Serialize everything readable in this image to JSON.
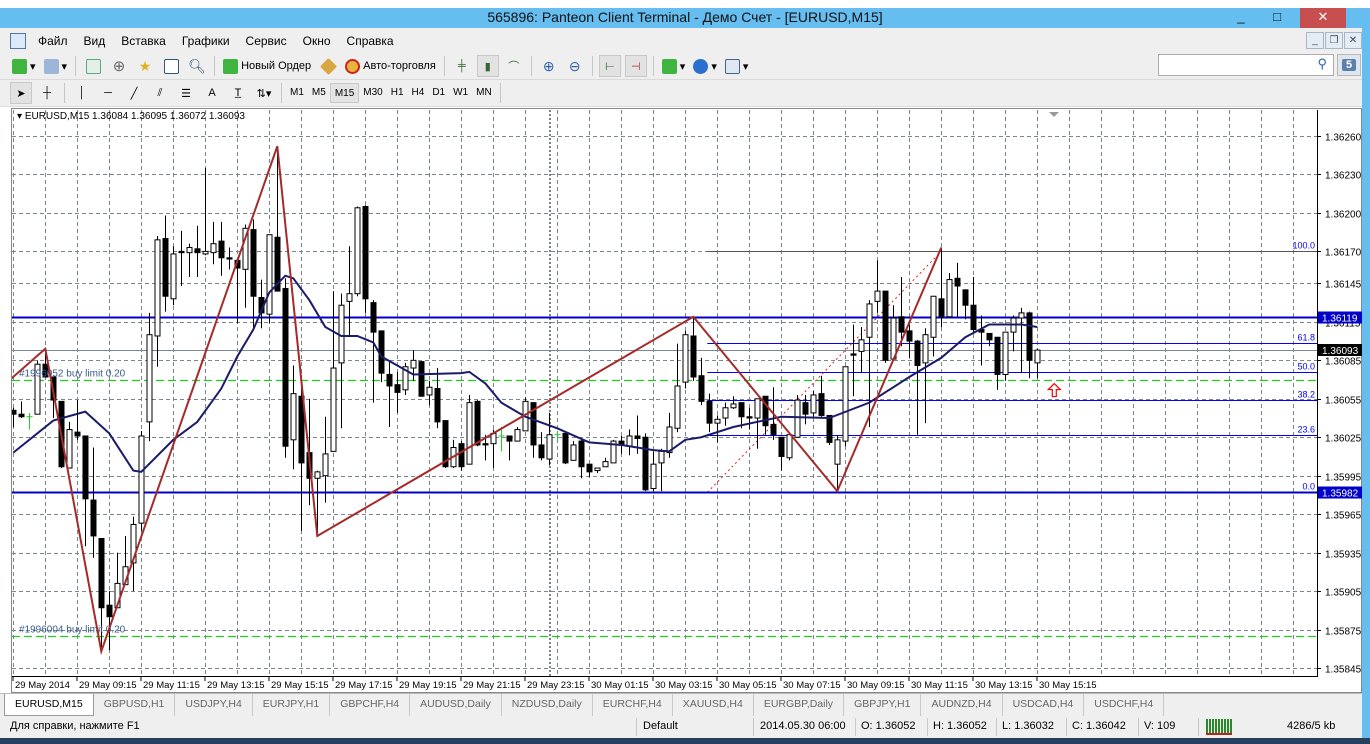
{
  "window": {
    "title": "565896: Panteon Client Terminal - Демо Счет - [EURUSD,M15]",
    "minimize": "_",
    "maximize": "□",
    "close": "✕"
  },
  "menu": [
    "Файл",
    "Вид",
    "Вставка",
    "Графики",
    "Сервис",
    "Окно",
    "Справка"
  ],
  "mdi_controls": {
    "minimize": "_",
    "restore": "❐",
    "close": "✕"
  },
  "toolbar": {
    "new_order": "Новый Ордер",
    "auto_trading": "Авто-торговля"
  },
  "timeframes": [
    "M1",
    "M5",
    "M15",
    "M30",
    "H1",
    "H4",
    "D1",
    "W1",
    "MN"
  ],
  "active_timeframe": "M15",
  "search": {
    "placeholder": "",
    "icon": "search-icon"
  },
  "chat": {
    "count": "5"
  },
  "chart": {
    "header": "EURUSD,M15  1.36084 1.36095 1.36072 1.36093",
    "orders": [
      {
        "label": "#1996052 buy limit 0.20",
        "price": 1.3607
      },
      {
        "label": "#1996004 buy limit 0.20",
        "price": 1.3587
      }
    ],
    "hlines": [
      {
        "price": 1.36119,
        "label": "1.36119"
      },
      {
        "price": 1.35982,
        "label": "1.35982"
      }
    ],
    "bid": {
      "price": 1.36093,
      "label": "1.36093"
    },
    "fibo": {
      "from_bar": 88,
      "high": 1.3617,
      "low": 1.35982,
      "levels": [
        {
          "label": "100.0",
          "ratio": 1
        },
        {
          "label": "61.8",
          "ratio": 0.618
        },
        {
          "label": "50.0",
          "ratio": 0.5
        },
        {
          "label": "38.2",
          "ratio": 0.382
        },
        {
          "label": "23.6",
          "ratio": 0.236
        },
        {
          "label": "0.0",
          "ratio": 0
        }
      ]
    },
    "colors": {
      "zigzag": "#a52a2a",
      "ma": "#1b1b6b",
      "hline": "#0000c8",
      "fibo": "#0000ff",
      "order": "#22cc22",
      "arrow": "#ff0000"
    }
  },
  "chart_data": {
    "type": "candlestick",
    "symbol": "EURUSD",
    "timeframe": "M15",
    "ylim": [
      1.3583,
      1.3628
    ],
    "price_ticks": [
      "1.36260",
      "1.36230",
      "1.36200",
      "1.36170",
      "1.36145",
      "1.36115",
      "1.36085",
      "1.36055",
      "1.36025",
      "1.35995",
      "1.35965",
      "1.35935",
      "1.35905",
      "1.35875",
      "1.35845"
    ],
    "time_ticks": [
      "29 May 2014",
      "29 May 09:15",
      "29 May 11:15",
      "29 May 13:15",
      "29 May 15:15",
      "29 May 17:15",
      "29 May 19:15",
      "29 May 21:15",
      "29 May 23:15",
      "30 May 01:15",
      "30 May 03:15",
      "30 May 05:15",
      "30 May 07:15",
      "30 May 09:15",
      "30 May 11:15",
      "30 May 13:15",
      "30 May 15:15"
    ],
    "grid": true,
    "ohlc": [
      [
        1.36046,
        1.36048,
        1.36033,
        1.36043
      ],
      [
        1.36043,
        1.36053,
        1.3604,
        1.36041
      ],
      [
        1.36041,
        1.36044,
        1.36031,
        1.36041
      ],
      [
        1.36043,
        1.36085,
        1.36043,
        1.36082
      ],
      [
        1.36082,
        1.36094,
        1.36072,
        1.36072
      ],
      [
        1.36072,
        1.36072,
        1.3604,
        1.36054
      ],
      [
        1.36053,
        1.36053,
        1.36001,
        1.36002
      ],
      [
        1.36001,
        1.36037,
        1.36001,
        1.36031
      ],
      [
        1.36029,
        1.36054,
        1.36023,
        1.36026
      ],
      [
        1.36026,
        1.36026,
        1.3594,
        1.35977
      ],
      [
        1.35976,
        1.36017,
        1.35931,
        1.35948
      ],
      [
        1.35946,
        1.35946,
        1.35858,
        1.35892
      ],
      [
        1.35894,
        1.35905,
        1.35859,
        1.35885
      ],
      [
        1.35892,
        1.35935,
        1.35892,
        1.35911
      ],
      [
        1.3591,
        1.35948,
        1.3591,
        1.35924
      ],
      [
        1.35927,
        1.35963,
        1.35905,
        1.35957
      ],
      [
        1.35958,
        1.3603,
        1.35952,
        1.36026
      ],
      [
        1.36037,
        1.36122,
        1.36022,
        1.36105
      ],
      [
        1.36104,
        1.36182,
        1.3608,
        1.36179
      ],
      [
        1.3618,
        1.36198,
        1.36123,
        1.36135
      ],
      [
        1.36133,
        1.36174,
        1.36128,
        1.36168
      ],
      [
        1.3617,
        1.36186,
        1.36143,
        1.36169
      ],
      [
        1.36169,
        1.36176,
        1.3615,
        1.36173
      ],
      [
        1.36172,
        1.3619,
        1.3615,
        1.36169
      ],
      [
        1.36168,
        1.36235,
        1.36167,
        1.3617
      ],
      [
        1.36169,
        1.36193,
        1.3616,
        1.36176
      ],
      [
        1.36178,
        1.36193,
        1.36151,
        1.36165
      ],
      [
        1.36165,
        1.36173,
        1.36156,
        1.36164
      ],
      [
        1.36163,
        1.36163,
        1.36114,
        1.36157
      ],
      [
        1.36156,
        1.36191,
        1.36126,
        1.36188
      ],
      [
        1.36187,
        1.36195,
        1.3611,
        1.36135
      ],
      [
        1.36134,
        1.36148,
        1.3611,
        1.36122
      ],
      [
        1.36121,
        1.36183,
        1.36114,
        1.36183
      ],
      [
        1.36181,
        1.36252,
        1.36139,
        1.36139
      ],
      [
        1.36141,
        1.36149,
        1.36009,
        1.36018
      ],
      [
        1.36023,
        1.36081,
        1.36,
        1.36059
      ],
      [
        1.36057,
        1.3607,
        1.35952,
        1.36005
      ],
      [
        1.36013,
        1.36055,
        1.35972,
        1.35993
      ],
      [
        1.35993,
        1.35999,
        1.35948,
        1.35998
      ],
      [
        1.35995,
        1.36041,
        1.35974,
        1.36012
      ],
      [
        1.36014,
        1.36139,
        1.36014,
        1.36079
      ],
      [
        1.36083,
        1.36137,
        1.36032,
        1.36128
      ],
      [
        1.36131,
        1.36174,
        1.36104,
        1.36137
      ],
      [
        1.36137,
        1.36205,
        1.36135,
        1.36204
      ],
      [
        1.36205,
        1.36206,
        1.36122,
        1.36133
      ],
      [
        1.3613,
        1.36132,
        1.36052,
        1.36107
      ],
      [
        1.36108,
        1.36108,
        1.36068,
        1.36075
      ],
      [
        1.36074,
        1.36085,
        1.36033,
        1.36065
      ],
      [
        1.36066,
        1.36076,
        1.36044,
        1.3606
      ],
      [
        1.36062,
        1.36083,
        1.36058,
        1.3608
      ],
      [
        1.36079,
        1.36093,
        1.36069,
        1.36085
      ],
      [
        1.36084,
        1.36084,
        1.36057,
        1.36057
      ],
      [
        1.36058,
        1.36069,
        1.3605,
        1.36064
      ],
      [
        1.36063,
        1.36079,
        1.36032,
        1.36037
      ],
      [
        1.36038,
        1.36038,
        1.36001,
        1.36002
      ],
      [
        1.36002,
        1.36023,
        1.36001,
        1.36017
      ],
      [
        1.3602,
        1.36022,
        1.35999,
        1.36002
      ],
      [
        1.36004,
        1.36058,
        1.36004,
        1.36052
      ],
      [
        1.36053,
        1.36054,
        1.36018,
        1.36019
      ],
      [
        1.3602,
        1.36027,
        1.36007,
        1.36019
      ],
      [
        1.3602,
        1.36031,
        1.36001,
        1.36028
      ],
      [
        1.36026,
        1.36033,
        1.36014,
        1.36026
      ],
      [
        1.36026,
        1.36026,
        1.36007,
        1.36022
      ],
      [
        1.36022,
        1.36033,
        1.36022,
        1.36031
      ],
      [
        1.3603,
        1.36056,
        1.3603,
        1.36053
      ],
      [
        1.36052,
        1.36052,
        1.36009,
        1.36019
      ],
      [
        1.36019,
        1.36029,
        1.36007,
        1.36009
      ],
      [
        1.36008,
        1.36044,
        1.36003,
        1.36027
      ],
      [
        1.36027,
        1.3603,
        1.36022,
        1.36027
      ],
      [
        1.36028,
        1.36028,
        1.36004,
        1.36005
      ],
      [
        1.36007,
        1.36022,
        1.36007,
        1.36019
      ],
      [
        1.36022,
        1.36023,
        1.35993,
        1.36002
      ],
      [
        1.36004,
        1.36004,
        1.35994,
        1.35998
      ],
      [
        1.35999,
        1.36001,
        1.35997,
        1.36001
      ],
      [
        1.36002,
        1.36009,
        1.36002,
        1.36006
      ],
      [
        1.36005,
        1.36023,
        1.36005,
        1.36022
      ],
      [
        1.36022,
        1.36026,
        1.36012,
        1.36019
      ],
      [
        1.36018,
        1.36031,
        1.36011,
        1.36026
      ],
      [
        1.36026,
        1.36042,
        1.36012,
        1.36024
      ],
      [
        1.36025,
        1.36028,
        1.35983,
        1.35984
      ],
      [
        1.35985,
        1.36014,
        1.35983,
        1.36004
      ],
      [
        1.36005,
        1.36016,
        1.35983,
        1.36014
      ],
      [
        1.36013,
        1.36044,
        1.36009,
        1.36033
      ],
      [
        1.36032,
        1.36098,
        1.36029,
        1.36065
      ],
      [
        1.36068,
        1.36108,
        1.36063,
        1.36105
      ],
      [
        1.36104,
        1.36119,
        1.36069,
        1.36072
      ],
      [
        1.36073,
        1.36087,
        1.3605,
        1.36053
      ],
      [
        1.36053,
        1.36059,
        1.36029,
        1.36036
      ],
      [
        1.36036,
        1.36042,
        1.36021,
        1.36039
      ],
      [
        1.3604,
        1.36052,
        1.36034,
        1.36048
      ],
      [
        1.36048,
        1.36057,
        1.36047,
        1.36051
      ],
      [
        1.36052,
        1.36052,
        1.36032,
        1.36041
      ],
      [
        1.36041,
        1.36048,
        1.36031,
        1.3604
      ],
      [
        1.3604,
        1.36055,
        1.36016,
        1.36055
      ],
      [
        1.36057,
        1.36057,
        1.36027,
        1.36034
      ],
      [
        1.36035,
        1.36064,
        1.36023,
        1.36027
      ],
      [
        1.36025,
        1.36025,
        1.35999,
        1.3601
      ],
      [
        1.36009,
        1.36027,
        1.36007,
        1.36027
      ],
      [
        1.36025,
        1.36058,
        1.36025,
        1.36054
      ],
      [
        1.36052,
        1.36058,
        1.36035,
        1.36043
      ],
      [
        1.36044,
        1.36061,
        1.36041,
        1.36058
      ],
      [
        1.36059,
        1.36073,
        1.36041,
        1.36042
      ],
      [
        1.36042,
        1.36042,
        1.36019,
        1.36021
      ],
      [
        1.36004,
        1.36026,
        1.35983,
        1.36023
      ],
      [
        1.36022,
        1.3608,
        1.36018,
        1.3608
      ],
      [
        1.3609,
        1.36113,
        1.36057,
        1.36089
      ],
      [
        1.36092,
        1.36111,
        1.36075,
        1.36101
      ],
      [
        1.36103,
        1.36132,
        1.36033,
        1.36129
      ],
      [
        1.36131,
        1.36163,
        1.36122,
        1.36139
      ],
      [
        1.36139,
        1.36139,
        1.36083,
        1.36085
      ],
      [
        1.36086,
        1.36128,
        1.36086,
        1.36118
      ],
      [
        1.36119,
        1.3615,
        1.36096,
        1.36107
      ],
      [
        1.36108,
        1.36113,
        1.36087,
        1.361
      ],
      [
        1.361,
        1.36101,
        1.36027,
        1.36081
      ],
      [
        1.36083,
        1.3611,
        1.36036,
        1.36105
      ],
      [
        1.36103,
        1.36135,
        1.36088,
        1.36135
      ],
      [
        1.36133,
        1.36173,
        1.36111,
        1.36119
      ],
      [
        1.36119,
        1.36153,
        1.36119,
        1.36148
      ],
      [
        1.36149,
        1.36161,
        1.36119,
        1.36143
      ],
      [
        1.3614,
        1.3614,
        1.36117,
        1.36128
      ],
      [
        1.36128,
        1.3615,
        1.36106,
        1.36109
      ],
      [
        1.36109,
        1.3612,
        1.36081,
        1.36107
      ],
      [
        1.36106,
        1.36106,
        1.36096,
        1.36101
      ],
      [
        1.36103,
        1.36103,
        1.36062,
        1.36074
      ],
      [
        1.36074,
        1.36107,
        1.36069,
        1.36107
      ],
      [
        1.36107,
        1.3612,
        1.36092,
        1.36118
      ],
      [
        1.36118,
        1.36126,
        1.36075,
        1.36122
      ],
      [
        1.36122,
        1.36123,
        1.36071,
        1.36085
      ],
      [
        1.36083,
        1.36094,
        1.36071,
        1.36093
      ]
    ],
    "moving_average": [
      [
        1,
        1.36013
      ],
      [
        6,
        1.36038
      ],
      [
        10,
        1.36045
      ],
      [
        13,
        1.36028
      ],
      [
        16,
        1.35999
      ],
      [
        17,
        1.35998
      ],
      [
        21,
        1.36023
      ],
      [
        24,
        1.36037
      ],
      [
        27,
        1.36063
      ],
      [
        29,
        1.36088
      ],
      [
        31,
        1.36109
      ],
      [
        33,
        1.36138
      ],
      [
        35,
        1.36151
      ],
      [
        36,
        1.36149
      ],
      [
        38,
        1.36132
      ],
      [
        40,
        1.36111
      ],
      [
        42,
        1.36104
      ],
      [
        44,
        1.36104
      ],
      [
        46,
        1.36099
      ],
      [
        47,
        1.36088
      ],
      [
        51,
        1.36074
      ],
      [
        57,
        1.36075
      ],
      [
        58,
        1.36076
      ],
      [
        60,
        1.36067
      ],
      [
        62,
        1.36052
      ],
      [
        65,
        1.36041
      ],
      [
        69,
        1.36032
      ],
      [
        73,
        1.36021
      ],
      [
        77,
        1.36019
      ],
      [
        81,
        1.36015
      ],
      [
        83,
        1.36014
      ],
      [
        85,
        1.36023
      ],
      [
        87,
        1.36025
      ],
      [
        91,
        1.36033
      ],
      [
        97,
        1.36041
      ],
      [
        103,
        1.3604
      ],
      [
        108,
        1.36052
      ],
      [
        113,
        1.36072
      ],
      [
        117,
        1.36087
      ],
      [
        120,
        1.36103
      ],
      [
        123,
        1.36113
      ],
      [
        127,
        1.36113
      ],
      [
        129,
        1.36111
      ]
    ],
    "zigzag": [
      [
        0.6,
        1.3607
      ],
      [
        5,
        1.36094
      ],
      [
        12,
        1.35858
      ],
      [
        34,
        1.36252
      ],
      [
        39,
        1.35948
      ],
      [
        86,
        1.36119
      ],
      [
        104,
        1.35983
      ],
      [
        117,
        1.36173
      ]
    ],
    "doji_bars": [
      3,
      62,
      69
    ]
  },
  "tabs": [
    "EURUSD,M15",
    "GBPUSD,H1",
    "USDJPY,H4",
    "EURJPY,H1",
    "GBPCHF,H4",
    "AUDUSD,Daily",
    "NZDUSD,Daily",
    "EURCHF,H4",
    "XAUUSD,H4",
    "EURGBP,Daily",
    "GBPJPY,H1",
    "AUDNZD,H4",
    "USDCAD,H4",
    "USDCHF,H4"
  ],
  "status": {
    "help": "Для справки, нажмите F1",
    "profile": "Default",
    "time": "2014.05.30 06:00",
    "open": "O: 1.36052",
    "high": "H: 1.36052",
    "low": "L: 1.36032",
    "close": "C: 1.36042",
    "volume": "V: 109",
    "traffic": "4286/5 kb"
  }
}
